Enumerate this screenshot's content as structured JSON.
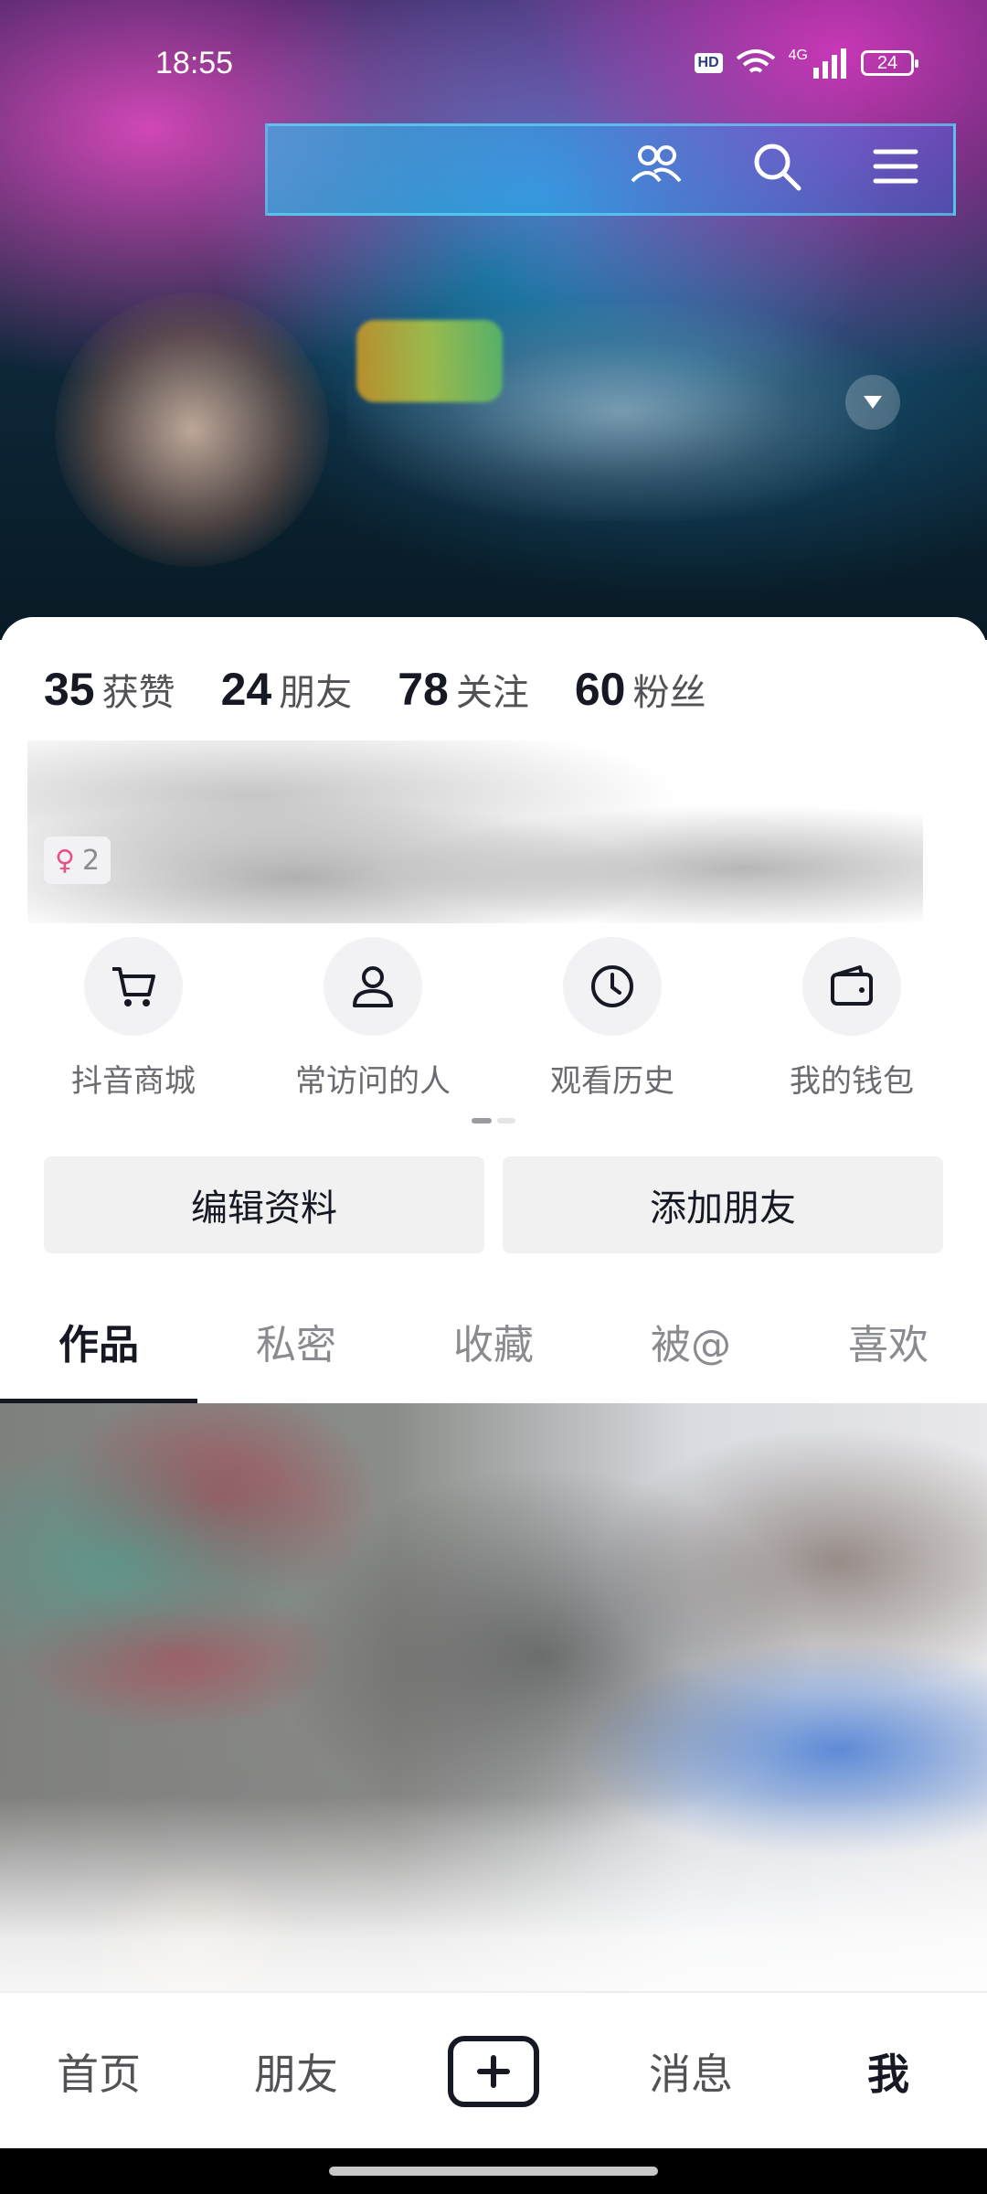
{
  "status_bar": {
    "time": "18:55",
    "hd_label": "HD",
    "network_label": "4G",
    "battery": "24"
  },
  "header": {
    "icons": [
      "friends-icon",
      "search-icon",
      "menu-icon",
      "dropdown-icon"
    ]
  },
  "stats": [
    {
      "number": "35",
      "label": "获赞"
    },
    {
      "number": "24",
      "label": "朋友"
    },
    {
      "number": "78",
      "label": "关注"
    },
    {
      "number": "60",
      "label": "粉丝"
    }
  ],
  "profile": {
    "tag_text": "2"
  },
  "quick_actions": [
    {
      "label": "抖音商城",
      "icon": "cart-icon"
    },
    {
      "label": "常访问的人",
      "icon": "person-icon"
    },
    {
      "label": "观看历史",
      "icon": "clock-icon"
    },
    {
      "label": "我的钱包",
      "icon": "wallet-icon"
    }
  ],
  "buttons": {
    "edit_profile": "编辑资料",
    "add_friend": "添加朋友"
  },
  "tabs": [
    {
      "label": "作品",
      "active": true
    },
    {
      "label": "私密",
      "active": false
    },
    {
      "label": "收藏",
      "active": false
    },
    {
      "label": "被@",
      "active": false
    },
    {
      "label": "喜欢",
      "active": false
    }
  ],
  "bottom_nav": {
    "home": "首页",
    "friends": "朋友",
    "messages": "消息",
    "me": "我"
  },
  "colors": {
    "text_primary": "#161823",
    "text_secondary": "#505256",
    "button_bg": "#f1f1f2"
  }
}
